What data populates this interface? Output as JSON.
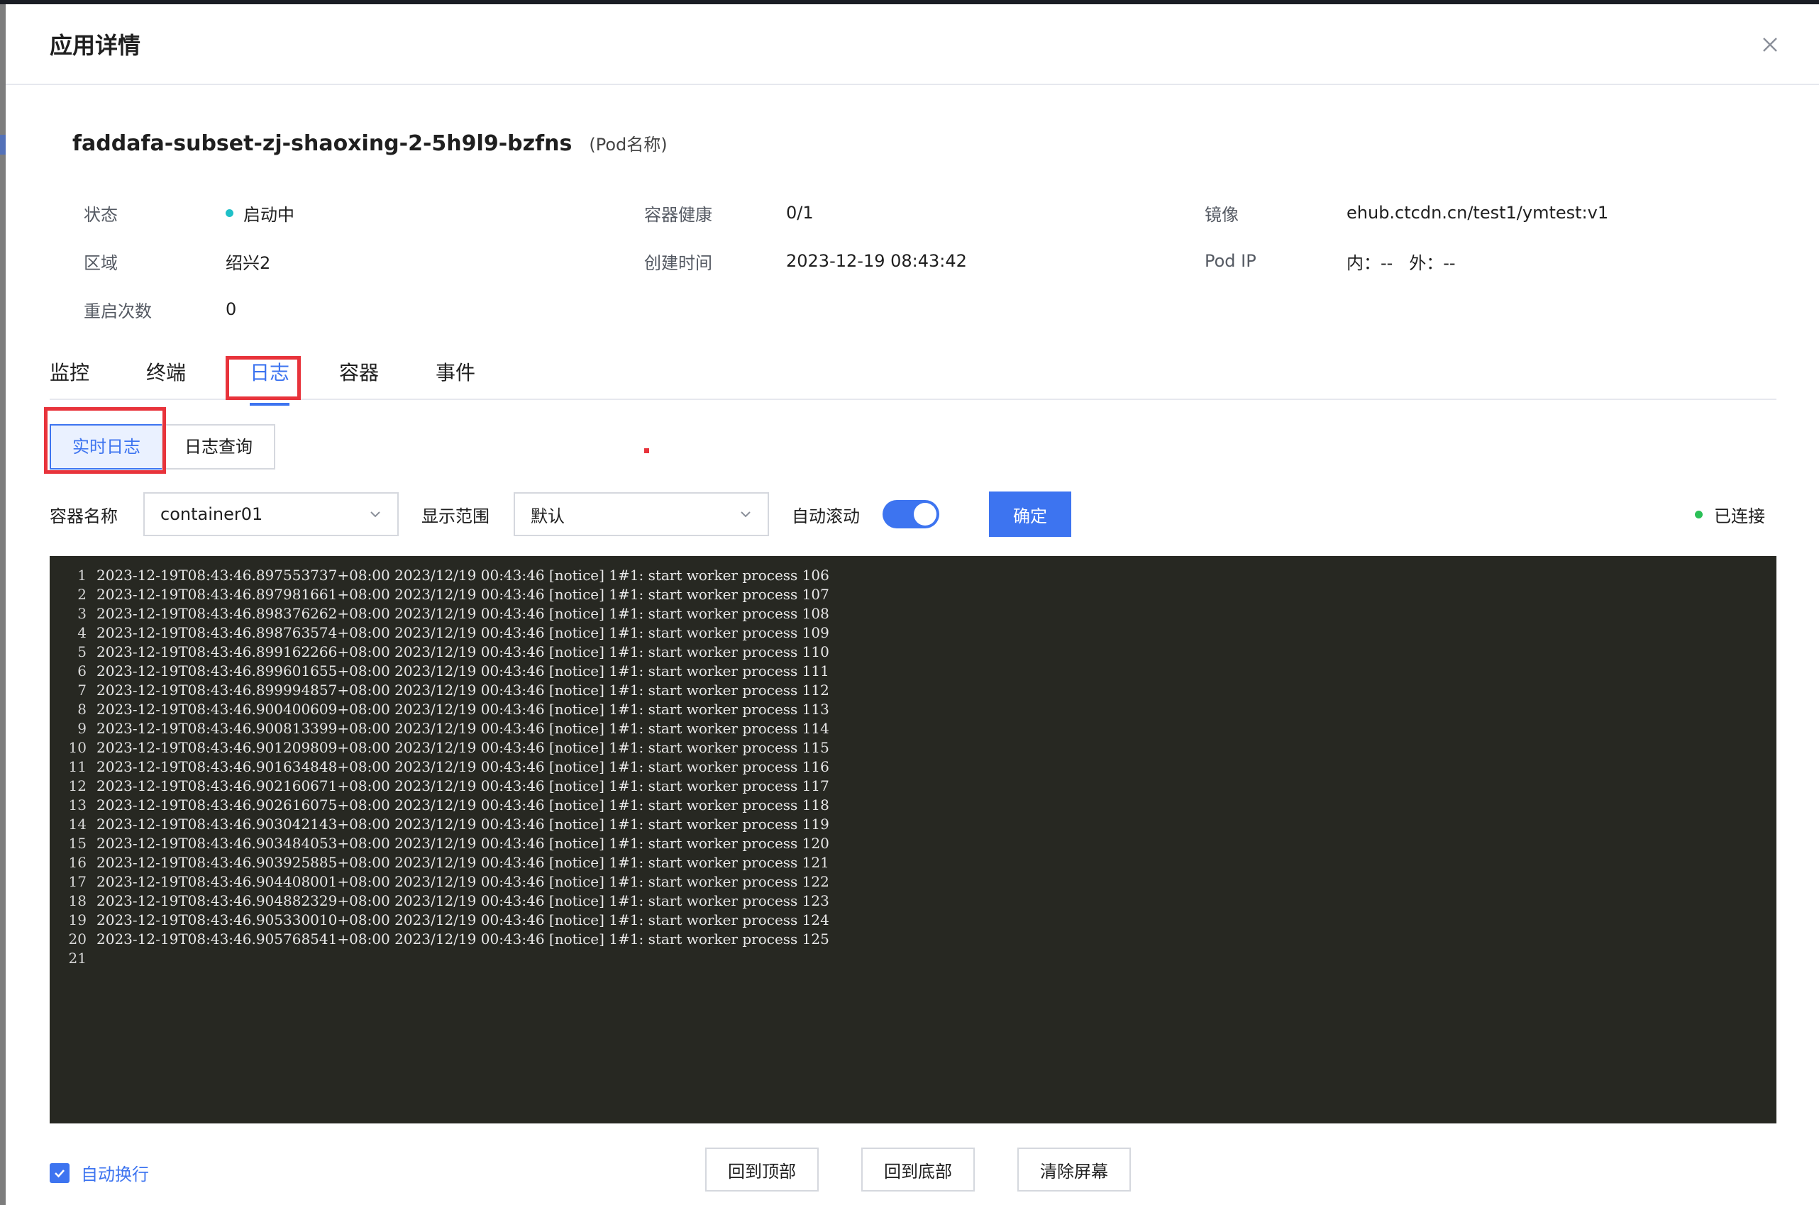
{
  "modal": {
    "title": "应用详情",
    "close_icon": "close-icon"
  },
  "pod": {
    "name": "faddafa-subset-zj-shaoxing-2-5h9l9-bzfns",
    "name_hint": "(Pod名称)"
  },
  "info": {
    "status_label": "状态",
    "status_value": "启动中",
    "status_color": "#1fc0c8",
    "health_label": "容器健康",
    "health_value": "0/1",
    "image_label": "镜像",
    "image_value": "ehub.ctcdn.cn/test1/ymtest:v1",
    "region_label": "区域",
    "region_value": "绍兴2",
    "created_label": "创建时间",
    "created_value": "2023-12-19 08:43:42",
    "podip_label": "Pod IP",
    "podip_value": "内：--   外：--",
    "restarts_label": "重启次数",
    "restarts_value": "0"
  },
  "tabs": [
    {
      "label": "监控"
    },
    {
      "label": "终端"
    },
    {
      "label": "日志",
      "active": true
    },
    {
      "label": "容器"
    },
    {
      "label": "事件"
    }
  ],
  "subtabs": [
    {
      "label": "实时日志",
      "active": true
    },
    {
      "label": "日志查询"
    }
  ],
  "toolbar": {
    "container_label": "容器名称",
    "container_value": "container01",
    "range_label": "显示范围",
    "range_value": "默认",
    "autoscroll_label": "自动滚动",
    "autoscroll_on": true,
    "confirm_label": "确定",
    "connected_label": "已连接",
    "connected_color": "#2bc057"
  },
  "log_lines": [
    {
      "n": "1",
      "text": "2023-12-19T08:43:46.897553737+08:00 2023/12/19 00:43:46 [notice] 1#1: start worker process 106"
    },
    {
      "n": "2",
      "text": "2023-12-19T08:43:46.897981661+08:00 2023/12/19 00:43:46 [notice] 1#1: start worker process 107"
    },
    {
      "n": "3",
      "text": "2023-12-19T08:43:46.898376262+08:00 2023/12/19 00:43:46 [notice] 1#1: start worker process 108"
    },
    {
      "n": "4",
      "text": "2023-12-19T08:43:46.898763574+08:00 2023/12/19 00:43:46 [notice] 1#1: start worker process 109"
    },
    {
      "n": "5",
      "text": "2023-12-19T08:43:46.899162266+08:00 2023/12/19 00:43:46 [notice] 1#1: start worker process 110"
    },
    {
      "n": "6",
      "text": "2023-12-19T08:43:46.899601655+08:00 2023/12/19 00:43:46 [notice] 1#1: start worker process 111"
    },
    {
      "n": "7",
      "text": "2023-12-19T08:43:46.899994857+08:00 2023/12/19 00:43:46 [notice] 1#1: start worker process 112"
    },
    {
      "n": "8",
      "text": "2023-12-19T08:43:46.900400609+08:00 2023/12/19 00:43:46 [notice] 1#1: start worker process 113"
    },
    {
      "n": "9",
      "text": "2023-12-19T08:43:46.900813399+08:00 2023/12/19 00:43:46 [notice] 1#1: start worker process 114"
    },
    {
      "n": "10",
      "text": "2023-12-19T08:43:46.901209809+08:00 2023/12/19 00:43:46 [notice] 1#1: start worker process 115"
    },
    {
      "n": "11",
      "text": "2023-12-19T08:43:46.901634848+08:00 2023/12/19 00:43:46 [notice] 1#1: start worker process 116"
    },
    {
      "n": "12",
      "text": "2023-12-19T08:43:46.902160671+08:00 2023/12/19 00:43:46 [notice] 1#1: start worker process 117"
    },
    {
      "n": "13",
      "text": "2023-12-19T08:43:46.902616075+08:00 2023/12/19 00:43:46 [notice] 1#1: start worker process 118"
    },
    {
      "n": "14",
      "text": "2023-12-19T08:43:46.903042143+08:00 2023/12/19 00:43:46 [notice] 1#1: start worker process 119"
    },
    {
      "n": "15",
      "text": "2023-12-19T08:43:46.903484053+08:00 2023/12/19 00:43:46 [notice] 1#1: start worker process 120"
    },
    {
      "n": "16",
      "text": "2023-12-19T08:43:46.903925885+08:00 2023/12/19 00:43:46 [notice] 1#1: start worker process 121"
    },
    {
      "n": "17",
      "text": "2023-12-19T08:43:46.904408001+08:00 2023/12/19 00:43:46 [notice] 1#1: start worker process 122"
    },
    {
      "n": "18",
      "text": "2023-12-19T08:43:46.904882329+08:00 2023/12/19 00:43:46 [notice] 1#1: start worker process 123"
    },
    {
      "n": "19",
      "text": "2023-12-19T08:43:46.905330010+08:00 2023/12/19 00:43:46 [notice] 1#1: start worker process 124"
    },
    {
      "n": "20",
      "text": "2023-12-19T08:43:46.905768541+08:00 2023/12/19 00:43:46 [notice] 1#1: start worker process 125"
    },
    {
      "n": "21",
      "text": ""
    }
  ],
  "footer": {
    "wrap_label": "自动换行",
    "wrap_checked": true,
    "to_top_label": "回到顶部",
    "to_bottom_label": "回到底部",
    "clear_label": "清除屏幕"
  },
  "colors": {
    "accent": "#3d74f0",
    "highlight": "#e8333b",
    "terminal_bg": "#272822"
  }
}
